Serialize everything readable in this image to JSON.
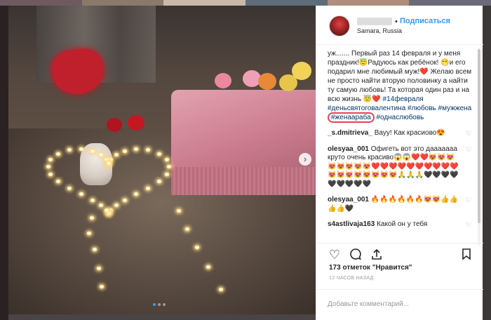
{
  "colors": {
    "accent": "#3897f0",
    "hashtag": "#003569",
    "highlight_circle": "#e8405a",
    "heart_red": "#ed4956"
  },
  "header": {
    "follow_dot": "•",
    "follow_label": "Подписаться",
    "location": "Samara, Russia"
  },
  "post": {
    "caption_start": "уж",
    "caption_text": "....... Первый раз 14 февраля и у меня праздник!😇Радуюсь как ребёнок! 😁и его подарил мне любимый муж!❤️ Желаю всем не просто найти вторую половинку а найти ту самую любовь! Та которая один раз и на всю жизнь 😇❤️",
    "hashtags_line1": "#14февраля #деньсвятоговалентина",
    "hashtags_line2": "#любовь #мужжена",
    "hashtag_circled": "#женаараба",
    "hashtags_line3": "#однаслюбовь"
  },
  "comments": [
    {
      "user": "_s.dmitrieva_",
      "text": "Вауу! Как красиово😍",
      "like_icon": "heart-outline"
    },
    {
      "user": "olesyaa_001",
      "text": "Офигеть вот это дааааааа круто очень красиво😱😱❤️❤️😻😻😻😻😻😻😻😻❤️❤️❤️❤️❤️❤️❤️❤️❤️❤️😻😻😻😻😻😻😻😻🙏🙏🙏🖤🖤🖤🖤🖤🖤🖤🖤🖤",
      "like_icon": "heart-outline"
    },
    {
      "user": "olesyaa_001",
      "text": "🔥🔥🔥🔥🔥🔥😻😻👍👍👍👍🖤",
      "like_icon": "heart-outline"
    },
    {
      "user": "s4astlivaja163",
      "text": "Какой он у тебя",
      "like_icon": "heart-outline"
    }
  ],
  "actions": {
    "like_icon": "heart-outline-icon",
    "comment_icon": "speech-bubble-icon",
    "share_icon": "upload-icon",
    "save_icon": "bookmark-icon"
  },
  "likes_text": "173 отметок \"Нравится\"",
  "time_text": "12 ЧАСОВ НАЗАД",
  "add_comment_placeholder": "Добавьте комментарий...",
  "carousel": {
    "slides": 3,
    "current": 1
  }
}
